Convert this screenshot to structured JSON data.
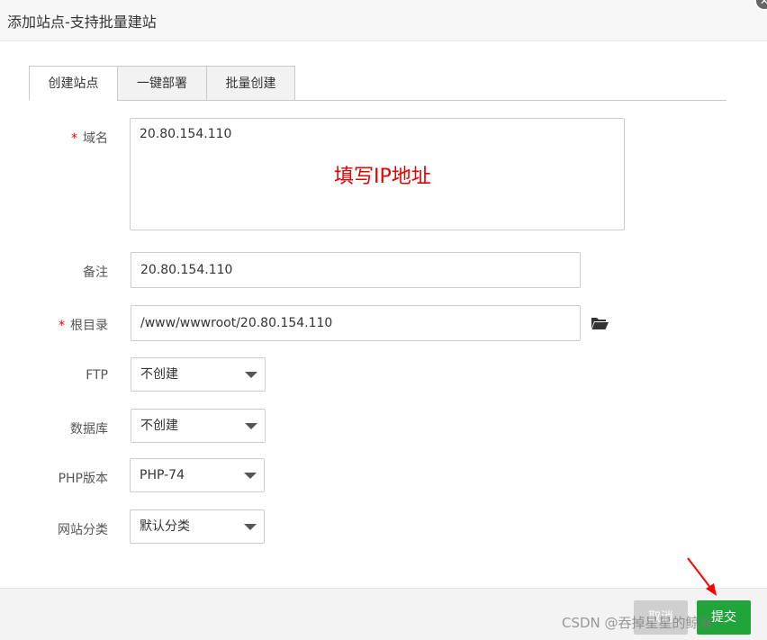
{
  "dialog": {
    "title": "添加站点-支持批量建站",
    "close_glyph": "✕"
  },
  "tabs": [
    {
      "label": "创建站点",
      "active": true
    },
    {
      "label": "一键部署",
      "active": false
    },
    {
      "label": "批量创建",
      "active": false
    }
  ],
  "form": {
    "required_mark": "*",
    "domain": {
      "label": "域名",
      "value": "20.80.154.110",
      "annotation": "填写IP地址"
    },
    "remark": {
      "label": "备注",
      "value": "20.80.154.110"
    },
    "root_dir": {
      "label": "根目录",
      "value": "/www/wwwroot/20.80.154.110",
      "icon": "folder-open-icon"
    },
    "ftp": {
      "label": "FTP",
      "selected": "不创建"
    },
    "database": {
      "label": "数据库",
      "selected": "不创建"
    },
    "php_version": {
      "label": "PHP版本",
      "selected": "PHP-74"
    },
    "site_category": {
      "label": "网站分类",
      "selected": "默认分类"
    }
  },
  "footer": {
    "cancel_label": "取消",
    "submit_label": "提交"
  },
  "watermark": "CSDN @吞掉星星的鲸鱼",
  "colors": {
    "submit_green": "#20a53a",
    "required_red": "#ff0000",
    "annotation_red": "#e60000",
    "arrow_red": "#ff0000"
  }
}
